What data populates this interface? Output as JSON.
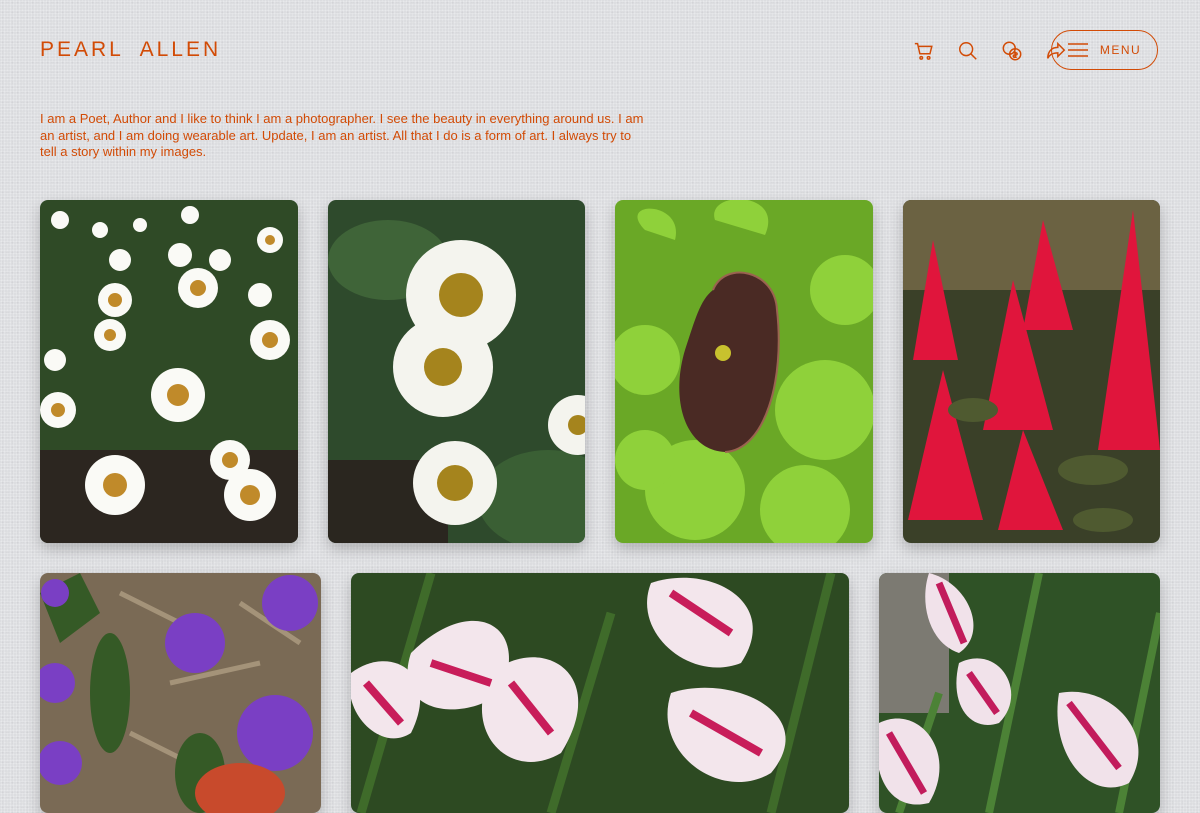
{
  "header": {
    "site_title": "PEARL  ALLEN",
    "menu_label": "MENU",
    "icons": [
      "cart-icon",
      "search-icon",
      "currency-icon",
      "share-icon",
      "hamburger-icon"
    ]
  },
  "bio": {
    "text": "I am a Poet, Author and I like to think I am a photographer. I see the beauty in everything around us. I am an artist, and I am doing wearable art. Update, I am an artist. All that I do is a form of art. I always try to tell a story within my images."
  },
  "colors": {
    "accent": "#d24b06",
    "background": "#dcdde0"
  },
  "gallery": {
    "photos": [
      {
        "subject": "white daisies field"
      },
      {
        "subject": "white daisies close-up"
      },
      {
        "subject": "dark pitcher flower with heart-shaped leaves"
      },
      {
        "subject": "red celosia plumes"
      },
      {
        "subject": "purple verbena with mulch"
      },
      {
        "subject": "pink striped crinum lilies"
      },
      {
        "subject": "pink crinum lilies"
      }
    ]
  }
}
